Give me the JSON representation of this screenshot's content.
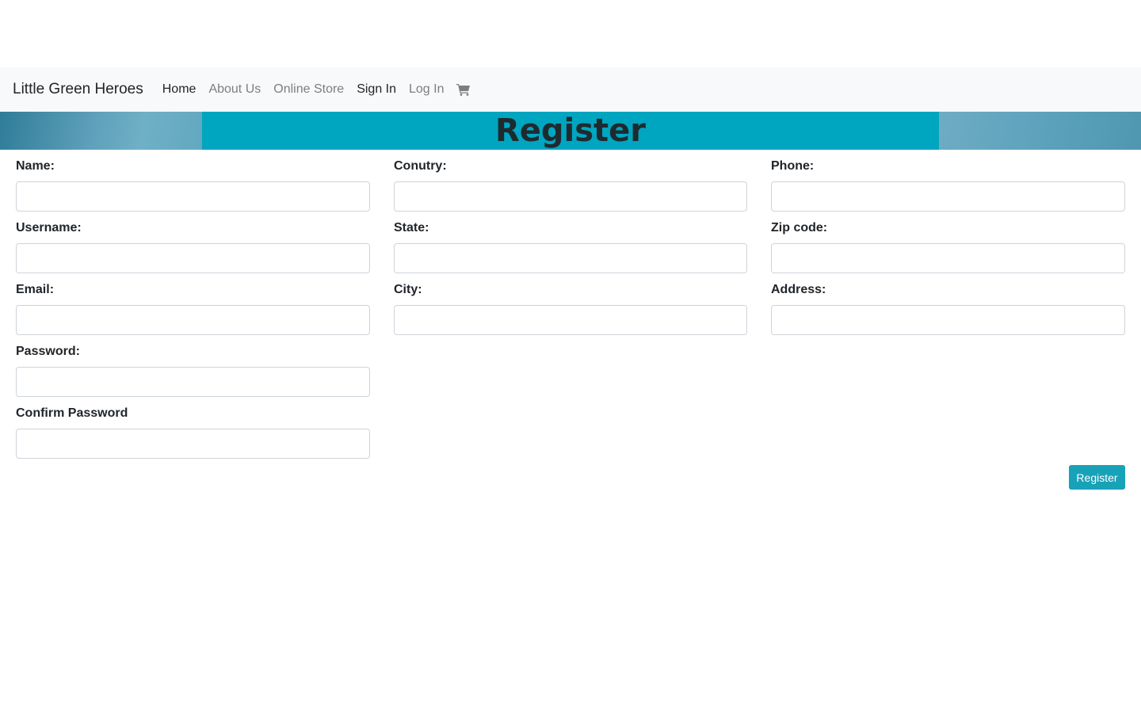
{
  "navbar": {
    "brand": "Little Green Heroes",
    "items": [
      {
        "label": "Home",
        "active": true
      },
      {
        "label": "About Us",
        "active": false
      },
      {
        "label": "Online Store",
        "active": false
      },
      {
        "label": "Sign In",
        "active": true
      },
      {
        "label": "Log In",
        "active": false
      }
    ],
    "cart_icon": "shopping-cart-icon"
  },
  "banner": {
    "title": "Register"
  },
  "form": {
    "columns": [
      [
        {
          "label": "Name:",
          "value": "",
          "placeholder": ""
        },
        {
          "label": "Username:",
          "value": "",
          "placeholder": ""
        },
        {
          "label": "Email:",
          "value": "",
          "placeholder": ""
        },
        {
          "label": "Password:",
          "value": "",
          "placeholder": ""
        },
        {
          "label": "Confirm Password",
          "value": "",
          "placeholder": ""
        }
      ],
      [
        {
          "label": "Conutry:",
          "value": "",
          "placeholder": ""
        },
        {
          "label": "State:",
          "value": "",
          "placeholder": ""
        },
        {
          "label": "City:",
          "value": "",
          "placeholder": ""
        }
      ],
      [
        {
          "label": "Phone:",
          "value": "",
          "placeholder": ""
        },
        {
          "label": "Zip code:",
          "value": "",
          "placeholder": ""
        },
        {
          "label": "Address:",
          "value": "",
          "placeholder": ""
        }
      ]
    ],
    "submit_label": "Register"
  },
  "colors": {
    "accent": "#17a2b8",
    "banner": "#00a5c0",
    "navbar_bg": "#f8f9fa"
  }
}
